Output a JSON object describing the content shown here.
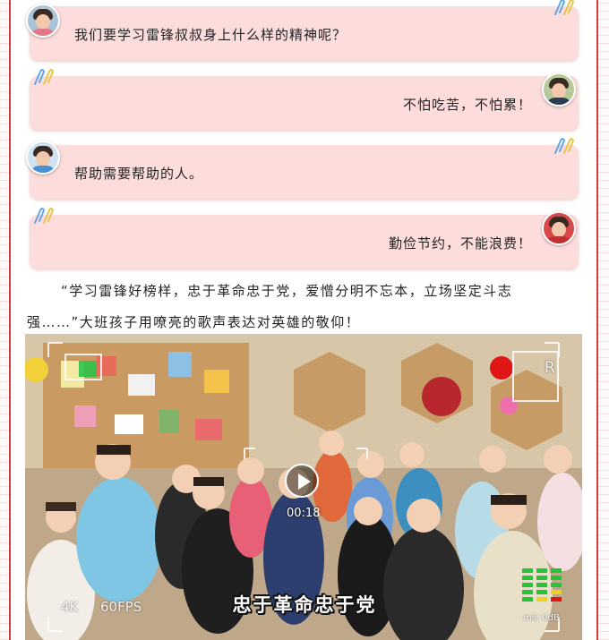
{
  "dialogue": [
    {
      "side": "left",
      "text": "我们要学习雷锋叔叔身上什么样的精神呢？"
    },
    {
      "side": "right",
      "text": "不怕吃苦，不怕累！"
    },
    {
      "side": "left",
      "text": "帮助需要帮助的人。"
    },
    {
      "side": "right",
      "text": "勤俭节约，不能浪费！"
    }
  ],
  "paragraph": {
    "line1": "“学习雷锋好榜样，忠于革命忠于党，爱憎分明不忘本，立场坚定斗志",
    "line2": "强……”大班孩子用嘹亮的歌声表达对英雄的敬仰！"
  },
  "video": {
    "duration": "00:18",
    "caption": "忠于革命忠于党",
    "hud_resolution": "4K",
    "hud_fps": "60FPS",
    "hud_rec": "R",
    "hud_mic_label": "mic 0dB"
  },
  "colors": {
    "bubble_bg": "#fddcdc",
    "frame_red": "#d23b3b",
    "record_dot": "#e01616"
  }
}
